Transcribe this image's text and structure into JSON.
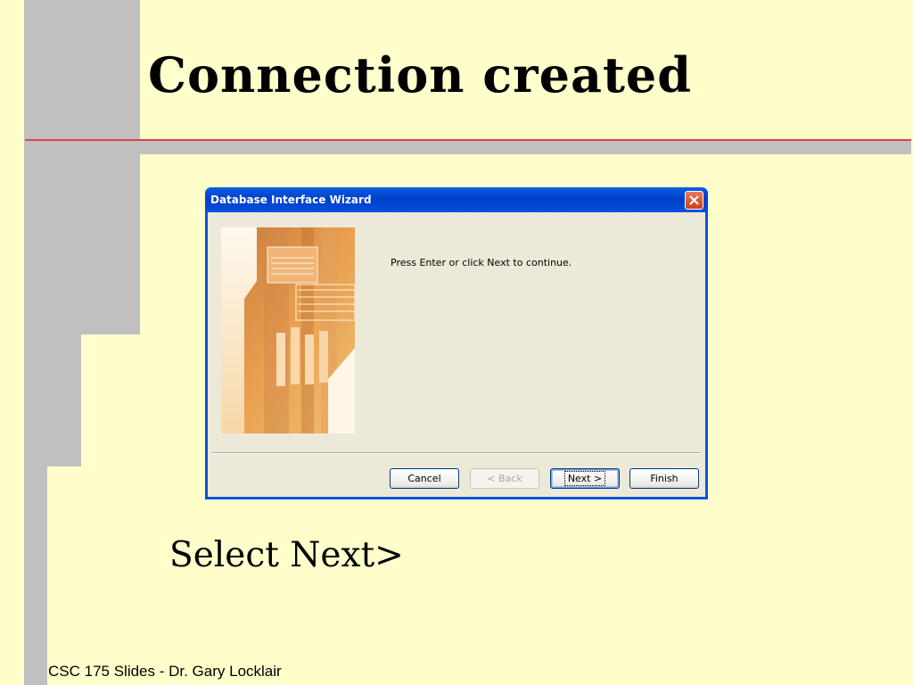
{
  "slide": {
    "title": "Connection created",
    "instruction": "Select Next>",
    "footer": "CSC 175 Slides - Dr. Gary Locklair",
    "colors": {
      "background": "#ffffcc",
      "decoration": "#c0c0c0",
      "rule": "#e04050"
    }
  },
  "dialog": {
    "title": "Database Interface Wizard",
    "close_icon": "close-icon",
    "message": "Press Enter or click Next to continue.",
    "buttons": {
      "cancel": "Cancel",
      "back": "< Back",
      "next": "Next >",
      "finish": "Finish"
    },
    "back_enabled": false,
    "default_button": "next"
  }
}
